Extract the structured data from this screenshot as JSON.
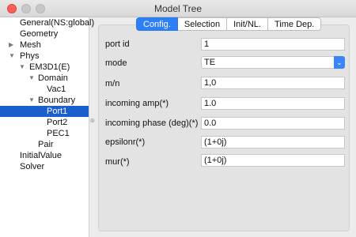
{
  "window": {
    "title": "Model Tree"
  },
  "tree": {
    "items": [
      {
        "label": "General(NS:global)",
        "arrow": ""
      },
      {
        "label": "Geometry",
        "arrow": ""
      },
      {
        "label": "Mesh",
        "arrow": "▶"
      },
      {
        "label": "Phys",
        "arrow": "▼"
      },
      {
        "label": "EM3D1(E)",
        "arrow": "▼"
      },
      {
        "label": "Domain",
        "arrow": "▼"
      },
      {
        "label": "Vac1",
        "arrow": ""
      },
      {
        "label": "Boundary",
        "arrow": "▼"
      },
      {
        "label": "Port1",
        "arrow": "",
        "selected": true
      },
      {
        "label": "Port2",
        "arrow": ""
      },
      {
        "label": "PEC1",
        "arrow": ""
      },
      {
        "label": "Pair",
        "arrow": ""
      },
      {
        "label": "InitialValue",
        "arrow": ""
      },
      {
        "label": "Solver",
        "arrow": ""
      }
    ]
  },
  "tabs": [
    {
      "label": "Config.",
      "active": true
    },
    {
      "label": "Selection"
    },
    {
      "label": "Init/NL."
    },
    {
      "label": "Time Dep."
    }
  ],
  "form": {
    "port_id": {
      "label": "port id",
      "value": "1"
    },
    "mode": {
      "label": "mode",
      "value": "TE"
    },
    "mn": {
      "label": "m/n",
      "value": "1,0"
    },
    "incoming_amp": {
      "label": "incoming amp(*)",
      "value": "1.0"
    },
    "incoming_phase": {
      "label": "incoming phase (deg)(*)",
      "value": "0.0"
    },
    "epsilonr": {
      "label": "epsilonr(*)",
      "value": "(1+0j)"
    },
    "mur": {
      "label": "mur(*)",
      "value": "(1+0j)"
    }
  },
  "icons": {
    "select_chevron": "chevron-updown-icon",
    "splitter": "splitter-grip-icon"
  }
}
